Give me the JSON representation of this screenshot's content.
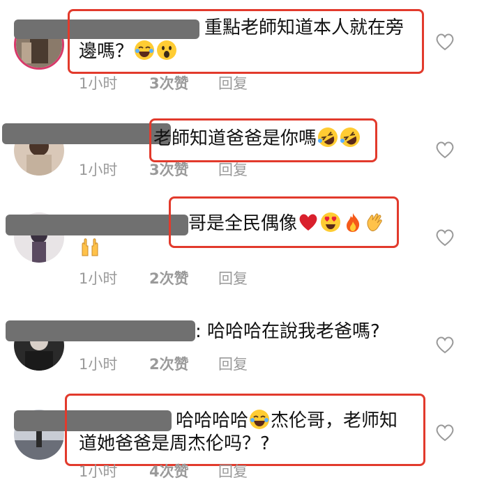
{
  "comments": [
    {
      "text_line1": "重點老師知道本人就在旁",
      "text_line2": "邊嗎？",
      "emojis": [
        "laughing-tears-emoji",
        "surprised-face-emoji"
      ],
      "time": "1小时",
      "likes": "3次赞",
      "reply": "回复"
    },
    {
      "text_line1": "老師知道爸爸是你嗎",
      "emojis": [
        "rolling-laughing-emoji",
        "rolling-laughing-emoji"
      ],
      "time": "1小时",
      "likes": "3次赞",
      "reply": "回复"
    },
    {
      "text_line1": "哥是全民偶像",
      "emojis": [
        "red-heart-emoji",
        "heart-eyes-emoji",
        "fire-emoji",
        "clapping-hands-emoji"
      ],
      "emojis_line2": [
        "raising-hands-emoji"
      ],
      "time": "1小时",
      "likes": "2次赞",
      "reply": "回复"
    },
    {
      "text_line1": ":  哈哈哈在說我老爸嗎?",
      "time": "1小时",
      "likes": "2次赞",
      "reply": "回复"
    },
    {
      "text_line1_a": "哈哈哈哈",
      "text_line1_b": "杰伦哥，老师知",
      "text_line2": "道她爸爸是周杰伦吗？?",
      "emojis": [
        "laughing-tears-emoji"
      ],
      "time": "1小时",
      "likes": "4次赞",
      "reply": "回复"
    }
  ],
  "colors": {
    "highlight_box": "#e23a2c",
    "meta_text": "#9a9a9a",
    "redaction": "#707070"
  }
}
